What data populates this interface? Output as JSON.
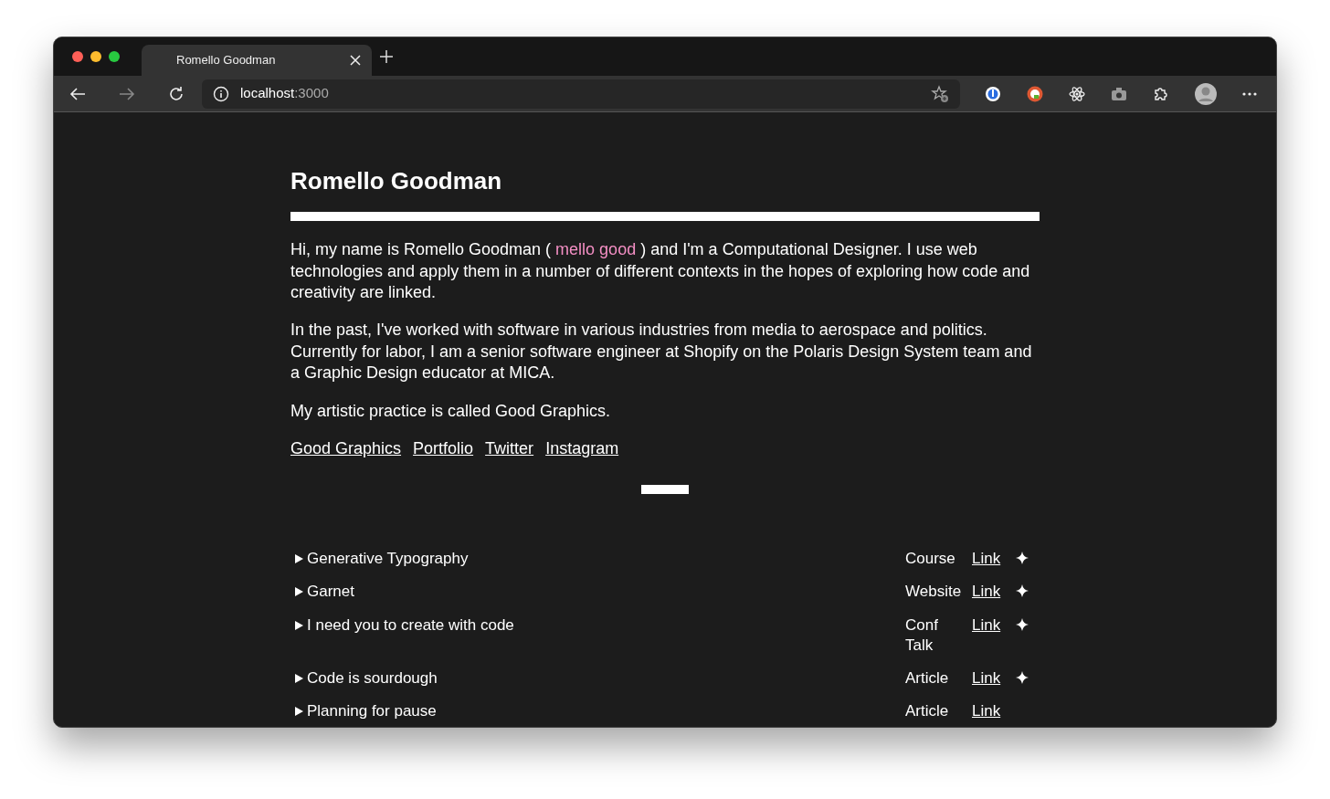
{
  "browser": {
    "tabs": [
      {
        "title": "Romello Goodman",
        "selected": true
      }
    ],
    "address": {
      "host": "localhost",
      "port": ":3000"
    }
  },
  "page": {
    "title": "Romello Goodman",
    "paragraphs": [
      {
        "before": "Hi, my name is Romello Goodman ( ",
        "highlight": "mello good",
        "after": " ) and I'm a Computational Designer. I use web technologies and apply them in a number of different contexts in the hopes of exploring how code and creativity are linked."
      },
      {
        "before": "In the past, I've worked with software in various industries from media to aerospace and politics. Currently for labor, I am a senior software engineer at Shopify on the Polaris Design System team and a Graphic Design educator at MICA."
      },
      {
        "before": "My artistic practice is called Good Graphics."
      }
    ],
    "links": [
      "Good Graphics",
      "Portfolio",
      "Twitter",
      "Instagram"
    ],
    "projects": [
      {
        "title": "Generative Typography",
        "expanded": false,
        "type": "Course",
        "link": "Link",
        "featured": true
      },
      {
        "title": "Garnet",
        "expanded": false,
        "type": "Website",
        "link": "Link",
        "featured": true
      },
      {
        "title": "I need you to create with code",
        "expanded": false,
        "type": "Conf Talk",
        "link": "Link",
        "featured": true
      },
      {
        "title": "Code is sourdough",
        "expanded": false,
        "type": "Article",
        "link": "Link",
        "featured": true
      },
      {
        "title": "Planning for pause",
        "expanded": false,
        "type": "Article",
        "link": "Link",
        "featured": false
      }
    ]
  }
}
